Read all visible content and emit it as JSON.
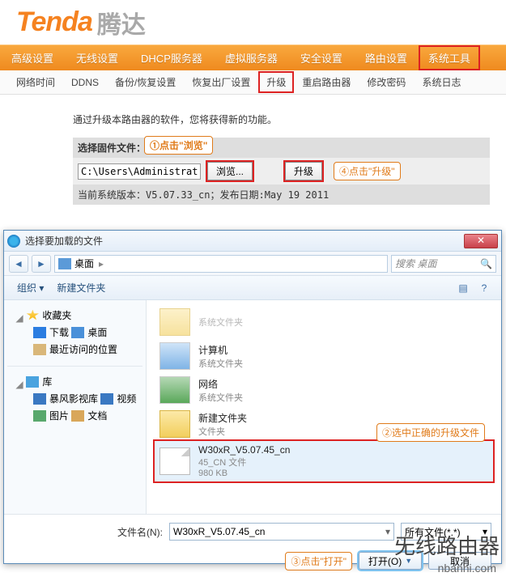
{
  "brand": {
    "logo": "Tenda",
    "cn": "腾达"
  },
  "main_nav": [
    "高级设置",
    "无线设置",
    "DHCP服务器",
    "虚拟服务器",
    "安全设置",
    "路由设置",
    "系统工具"
  ],
  "main_nav_highlight_index": 6,
  "sub_nav": [
    "网络时间",
    "DDNS",
    "备份/恢复设置",
    "恢复出厂设置",
    "升级",
    "重启路由器",
    "修改密码",
    "系统日志"
  ],
  "sub_nav_highlight_index": 4,
  "content": {
    "desc": "通过升级本路由器的软件，您将获得新的功能。",
    "select_label": "选择固件文件：",
    "path_value": "C:\\Users\\Administrato",
    "browse_btn": "浏览...",
    "upgrade_btn": "升级",
    "version_line": "当前系统版本：V5.07.33_cn；发布日期:May 19 2011"
  },
  "callouts": {
    "c1": "①点击\"浏览\"",
    "c2": "②选中正确的升级文件",
    "c3": "③点击\"打开\"",
    "c4": "④点击\"升级\""
  },
  "dialog": {
    "title": "选择要加载的文件",
    "breadcrumb_root": "桌面",
    "search_placeholder": "搜索 桌面",
    "toolbar": {
      "organize": "组织 ▾",
      "newfolder": "新建文件夹"
    },
    "tree": {
      "favorites": "收藏夹",
      "downloads": "下载",
      "desktop": "桌面",
      "recent": "最近访问的位置",
      "libraries": "库",
      "lib_video1": "暴风影视库",
      "lib_video2": "视频",
      "lib_pictures": "图片",
      "lib_docs": "文档"
    },
    "files": {
      "sysfolder_sub": "系统文件夹",
      "folder_sub": "文件夹",
      "computer": "计算机",
      "network": "网络",
      "newfolder": "新建文件夹",
      "firmware_name": "W30xR_V5.07.45_cn",
      "firmware_type": "45_CN 文件",
      "firmware_size": "980 KB"
    },
    "footer": {
      "filename_label": "文件名(N):",
      "filename_value": "W30xR_V5.07.45_cn",
      "filter": "所有文件(*.*)",
      "open": "打开(O)",
      "cancel": "取消"
    }
  },
  "watermark": {
    "main": "旡线路由器",
    "sub": "nbanhi.com"
  }
}
